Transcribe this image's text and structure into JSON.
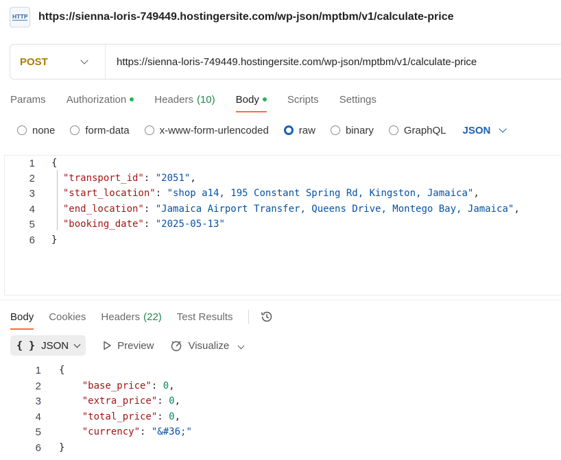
{
  "request": {
    "title": "https://sienna-loris-749449.hostingersite.com/wp-json/mptbm/v1/calculate-price",
    "http_icon_label": "HTTP",
    "method": "POST",
    "url": "https://sienna-loris-749449.hostingersite.com/wp-json/mptbm/v1/calculate-price"
  },
  "request_tabs": {
    "params": "Params",
    "authorization": "Authorization",
    "headers": "Headers",
    "headers_count": "(10)",
    "body": "Body",
    "scripts": "Scripts",
    "settings": "Settings"
  },
  "body_types": {
    "none": "none",
    "form_data": "form-data",
    "urlencoded": "x-www-form-urlencoded",
    "raw": "raw",
    "binary": "binary",
    "graphql": "GraphQL",
    "selected": "raw",
    "language": "JSON"
  },
  "request_body": {
    "line_numbers": [
      "1",
      "2",
      "3",
      "4",
      "5",
      "6"
    ],
    "open": "{",
    "close": "}",
    "fields": [
      {
        "key": "\"transport_id\"",
        "value": "\"2051\"",
        "sep": ",",
        "type": "string"
      },
      {
        "key": "\"start_location\"",
        "value": "\"shop a14, 195 Constant Spring Rd, Kingston, Jamaica\"",
        "sep": ",",
        "type": "string"
      },
      {
        "key": "\"end_location\"",
        "value": "\"Jamaica Airport Transfer, Queens Drive, Montego Bay, Jamaica\"",
        "sep": ",",
        "type": "string"
      },
      {
        "key": "\"booking_date\"",
        "value": "\"2025-05-13\"",
        "sep": "",
        "type": "string"
      }
    ]
  },
  "response_tabs": {
    "body": "Body",
    "cookies": "Cookies",
    "headers": "Headers",
    "headers_count": "(22)",
    "test_results": "Test Results"
  },
  "response_toolbar": {
    "braces": "{ }",
    "format": "JSON",
    "preview": "Preview",
    "visualize": "Visualize"
  },
  "response_body": {
    "line_numbers": [
      "1",
      "2",
      "3",
      "4",
      "5",
      "6"
    ],
    "open": "{",
    "close": "}",
    "fields": [
      {
        "key": "\"base_price\"",
        "value": "0",
        "sep": ",",
        "type": "number"
      },
      {
        "key": "\"extra_price\"",
        "value": "0",
        "sep": ",",
        "type": "number"
      },
      {
        "key": "\"total_price\"",
        "value": "0",
        "sep": ",",
        "type": "number"
      },
      {
        "key": "\"currency\"",
        "value": "\"&#36;\"",
        "sep": "",
        "type": "string"
      }
    ]
  },
  "colors": {
    "method_post": "#ad7a03",
    "active_tab_underline": "#ff6c37",
    "status_dot": "#1db954",
    "accent_blue": "#1a5fb4",
    "json_key": "#a31515",
    "json_string": "#0451a5",
    "json_number": "#098658"
  }
}
